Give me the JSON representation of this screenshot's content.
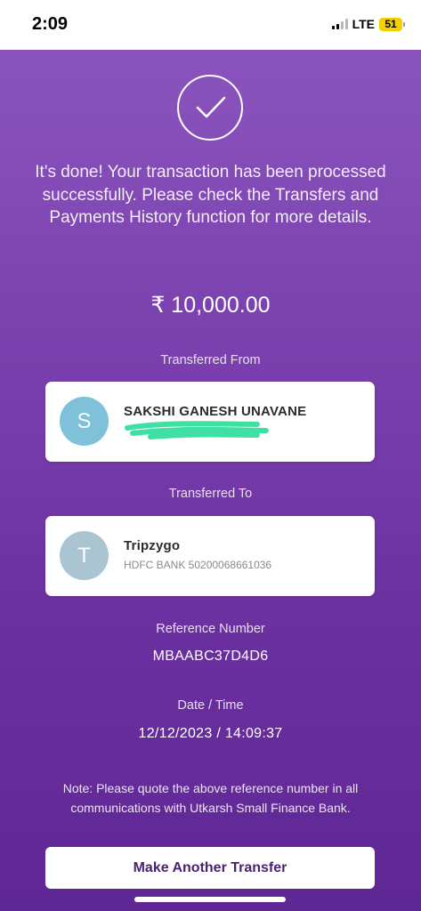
{
  "status_bar": {
    "time": "2:09",
    "network": "LTE",
    "battery": "51"
  },
  "confirmation": {
    "message": "It's done! Your transaction has been processed successfully. Please check the Transfers and Payments History function for more details.",
    "amount": "₹ 10,000.00"
  },
  "from": {
    "label": "Transferred From",
    "avatar_initial": "S",
    "avatar_color": "#7ec1d9",
    "name": "SAKSHI GANESH UNAVANE",
    "account_redacted": true
  },
  "to": {
    "label": "Transferred To",
    "avatar_initial": "T",
    "avatar_color": "#aac4d2",
    "name": "Tripzygo",
    "account": "HDFC BANK 50200068661036"
  },
  "reference": {
    "label": "Reference Number",
    "value": "MBAABC37D4D6"
  },
  "datetime": {
    "label": "Date / Time",
    "value": "12/12/2023 / 14:09:37"
  },
  "note": "Note: Please quote the above reference number in all communications with Utkarsh Small Finance Bank.",
  "actions": {
    "make_another_transfer": "Make Another Transfer"
  },
  "colors": {
    "gradient_top": "#8a54bd",
    "gradient_bottom": "#5e2794",
    "button_text": "#4a2273",
    "redaction_mark": "#3ee0a4"
  }
}
